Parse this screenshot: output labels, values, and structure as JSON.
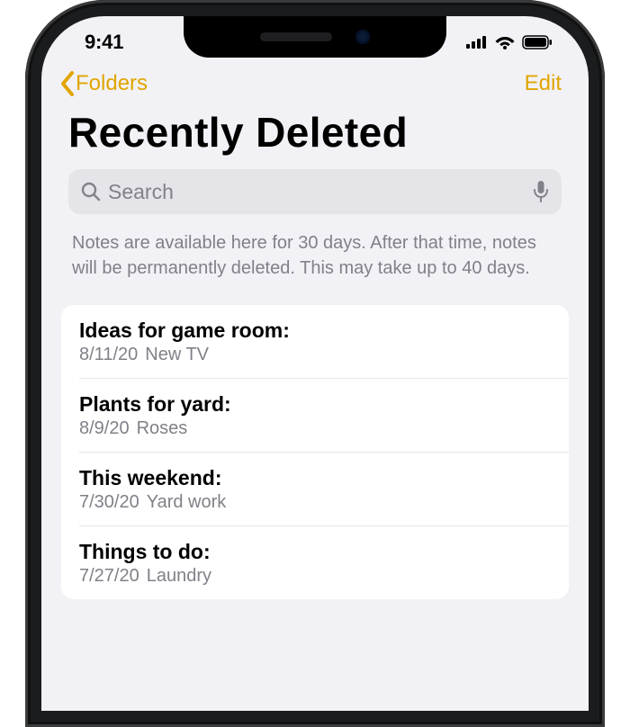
{
  "statusbar": {
    "time": "9:41"
  },
  "nav": {
    "back_label": "Folders",
    "edit_label": "Edit"
  },
  "page": {
    "title": "Recently Deleted",
    "search_placeholder": "Search",
    "info_text": "Notes are available here for 30 days. After that time, notes will be permanently deleted. This may take up to 40 days."
  },
  "notes": [
    {
      "title": "Ideas for game room:",
      "date": "8/11/20",
      "preview": "New TV"
    },
    {
      "title": "Plants for yard:",
      "date": "8/9/20",
      "preview": "Roses"
    },
    {
      "title": "This weekend:",
      "date": "7/30/20",
      "preview": "Yard work"
    },
    {
      "title": "Things to do:",
      "date": "7/27/20",
      "preview": "Laundry"
    }
  ],
  "accent": "#e1a500"
}
